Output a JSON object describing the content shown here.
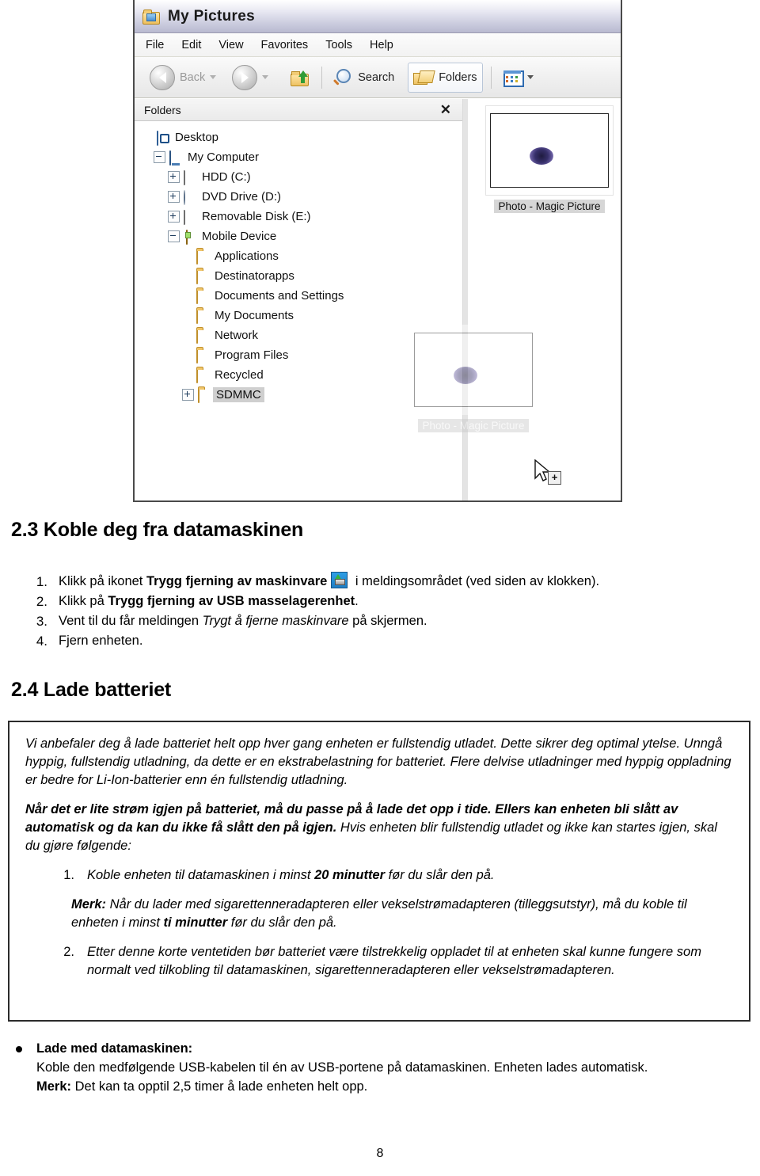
{
  "explorer": {
    "window_title": "My Pictures",
    "title_icon": "folder-pictures-icon",
    "menu": [
      "File",
      "Edit",
      "View",
      "Favorites",
      "Tools",
      "Help"
    ],
    "toolbar": {
      "back_label": "Back",
      "forward_label": "",
      "up_icon": "up-folder-icon",
      "search_label": "Search",
      "folders_label": "Folders",
      "views_icon": "views-icon"
    },
    "folders_pane": {
      "header": "Folders",
      "close_icon": "close-icon",
      "tree": [
        {
          "label": "Desktop",
          "icon": "desktop-icon",
          "indent": 0,
          "expander": "none"
        },
        {
          "label": "My Computer",
          "icon": "computer-icon",
          "indent": 1,
          "expander": "minus"
        },
        {
          "label": "HDD (C:)",
          "icon": "hdd-icon",
          "indent": 2,
          "expander": "plus"
        },
        {
          "label": "DVD Drive (D:)",
          "icon": "dvd-icon",
          "indent": 2,
          "expander": "plus"
        },
        {
          "label": "Removable Disk (E:)",
          "icon": "hdd-icon",
          "indent": 2,
          "expander": "plus"
        },
        {
          "label": "Mobile Device",
          "icon": "mobile-device-icon",
          "indent": 2,
          "expander": "minus"
        },
        {
          "label": "Applications",
          "icon": "folder-icon",
          "indent": 4,
          "expander": "none"
        },
        {
          "label": "Destinatorapps",
          "icon": "folder-icon",
          "indent": 4,
          "expander": "none"
        },
        {
          "label": "Documents and Settings",
          "icon": "folder-icon",
          "indent": 4,
          "expander": "none"
        },
        {
          "label": "My Documents",
          "icon": "folder-icon",
          "indent": 4,
          "expander": "none"
        },
        {
          "label": "Network",
          "icon": "folder-icon",
          "indent": 4,
          "expander": "none"
        },
        {
          "label": "Program Files",
          "icon": "folder-icon",
          "indent": 4,
          "expander": "none"
        },
        {
          "label": "Recycled",
          "icon": "folder-icon",
          "indent": 4,
          "expander": "none"
        },
        {
          "label": "SDMMC",
          "icon": "folder-icon",
          "indent": 3,
          "expander": "plus",
          "selected": true
        }
      ]
    },
    "content_pane": {
      "thumbnail_caption": "Photo - Magic Picture",
      "drag_caption": "Photo - Magic Picture",
      "drop_cursor_badge": "+"
    }
  },
  "doc": {
    "section_23": {
      "heading": "2.3 Koble deg fra datamaskinen",
      "steps": [
        {
          "num": "1.",
          "pre": "Klikk på ikonet ",
          "bold": "Trygg fjerning av maskinvare",
          "icon": "safe-remove-hardware-icon",
          "post": " i meldingsområdet (ved siden av klokken)."
        },
        {
          "num": "2.",
          "pre": "Klikk på ",
          "bold": "Trygg fjerning av USB masselagerenhet",
          "post": "."
        },
        {
          "num": "3.",
          "pre": "Vent til du får meldingen ",
          "italic": "Trygt å fjerne maskinvare",
          "post": " på skjermen."
        },
        {
          "num": "4.",
          "pre": "Fjern enheten.",
          "post": ""
        }
      ]
    },
    "section_24": {
      "heading": "2.4 Lade batteriet",
      "para1": "Vi anbefaler deg å lade batteriet helt opp hver gang enheten er fullstendig utladet. Dette sikrer deg optimal ytelse. Unngå hyppig, fullstendig utladning, da dette er en ekstrabelastning for batteriet. Flere delvise utladninger med hyppig oppladning er bedre for Li-Ion-batterier enn én fullstendig utladning.",
      "para2_bold": "Når det er lite strøm igjen på batteriet, må du passe på å lade det opp i tide. Ellers kan enheten bli slått av automatisk og da kan du ikke få slått den på igjen.",
      "para2_rest": " Hvis enheten blir fullstendig utladet og ikke kan startes igjen, skal du gjøre følgende:",
      "item1": {
        "num": "1.",
        "pre": "Koble enheten til datamaskinen i minst ",
        "bold": "20 minutter",
        "post": " før du slår den på."
      },
      "merk": {
        "label": "Merk:",
        "pre": " Når du lader med sigarettenneradapteren eller vekselstrømadapteren (tilleggsutstyr), må du koble til enheten i minst ",
        "bold": "ti minutter",
        "post": " før du slår den på."
      },
      "item2": {
        "num": "2.",
        "text": "Etter denne korte ventetiden bør batteriet være tilstrekkelig oppladet til at enheten skal kunne fungere som normalt ved tilkobling til datamaskinen, sigarettenneradapteren eller vekselstrømadapteren."
      }
    },
    "bullet": {
      "heading": "Lade med datamaskinen:",
      "body": "Koble den medfølgende USB-kabelen til én av USB-portene på datamaskinen. Enheten lades automatisk.",
      "merk_label": "Merk:",
      "merk_text": " Det kan ta opptil 2,5 timer å lade enheten helt opp."
    },
    "page_number": "8"
  }
}
